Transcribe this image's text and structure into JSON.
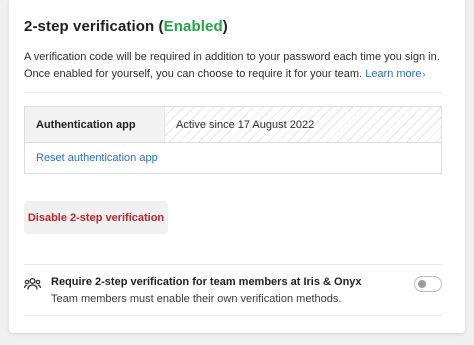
{
  "section": {
    "title": "2-step verification",
    "status_open": " (",
    "status": "Enabled",
    "status_close": ")",
    "description": "A verification code will be required in addition to your password each time you sign in. Once enabled for yourself, you can choose to require it for your team.",
    "learn_more": "Learn more",
    "learn_more_icon": "chevron-right-icon"
  },
  "auth": {
    "label": "Authentication app",
    "value": "Active since 17 August 2022",
    "reset_link": "Reset authentication app"
  },
  "disable_button": "Disable 2-step verification",
  "requirement": {
    "icon": "team-icon",
    "title": "Require 2-step verification for team members at Iris & Onyx",
    "subtitle": "Team members must enable their own verification methods.",
    "toggle_on": false
  },
  "colors": {
    "enabled": "#22a745",
    "link": "#2a6fd6",
    "danger": "#c0232d"
  }
}
